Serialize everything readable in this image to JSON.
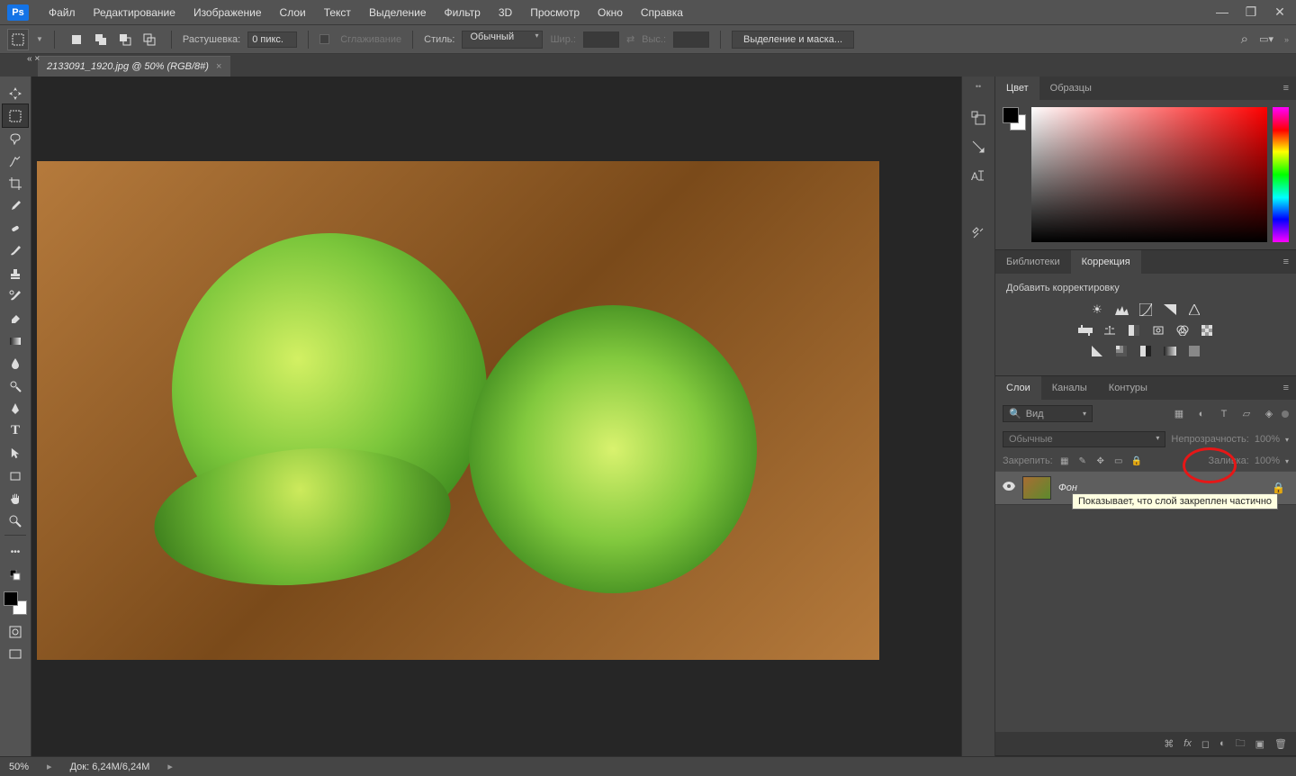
{
  "menu": {
    "items": [
      "Файл",
      "Редактирование",
      "Изображение",
      "Слои",
      "Текст",
      "Выделение",
      "Фильтр",
      "3D",
      "Просмотр",
      "Окно",
      "Справка"
    ]
  },
  "options": {
    "feather_label": "Растушевка:",
    "feather_value": "0 пикс.",
    "antialias_label": "Сглаживание",
    "style_label": "Стиль:",
    "style_value": "Обычный",
    "width_label": "Шир.:",
    "height_label": "Выс.:",
    "select_and_mask": "Выделение и маска..."
  },
  "document": {
    "tab_title": "2133091_1920.jpg @ 50% (RGB/8#)"
  },
  "panels": {
    "color_tabs": [
      "Цвет",
      "Образцы"
    ],
    "adjustments_tabs": [
      "Библиотеки",
      "Коррекция"
    ],
    "adjustments_title": "Добавить корректировку",
    "layers_tabs": [
      "Слои",
      "Каналы",
      "Контуры"
    ],
    "layer_filter_kind": "Вид",
    "blend_mode": "Обычные",
    "opacity_label": "Непрозрачность:",
    "opacity_value": "100%",
    "lock_label": "Закрепить:",
    "fill_label": "Заливка:",
    "fill_value": "100%",
    "layer_name": "Фон"
  },
  "tooltip": "Показывает, что слой закреплен частично",
  "status": {
    "zoom": "50%",
    "doc_size_label": "Док:",
    "doc_size": "6,24M/6,24M"
  }
}
